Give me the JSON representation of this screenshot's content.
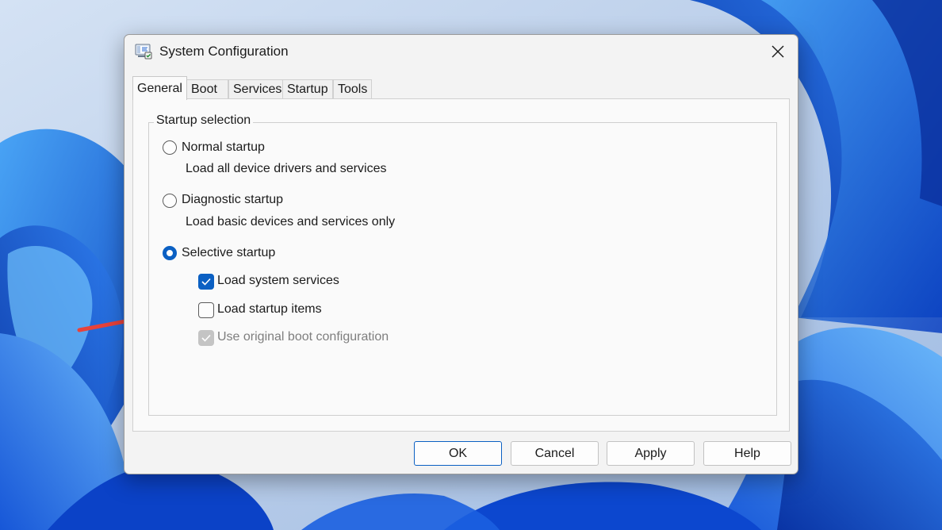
{
  "window": {
    "title": "System Configuration",
    "app_icon": "msconfig-icon",
    "close_icon": "close-icon"
  },
  "tabs": [
    {
      "label": "General",
      "active": true
    },
    {
      "label": "Boot",
      "active": false
    },
    {
      "label": "Services",
      "active": false
    },
    {
      "label": "Startup",
      "active": false
    },
    {
      "label": "Tools",
      "active": false
    }
  ],
  "startup_selection": {
    "label": "Startup selection",
    "normal": {
      "label": "Normal startup",
      "description": "Load all device drivers and services",
      "selected": false
    },
    "diagnostic": {
      "label": "Diagnostic startup",
      "description": "Load basic devices and services only",
      "selected": false
    },
    "selective": {
      "label": "Selective startup",
      "selected": true,
      "options": {
        "load_system_services": {
          "label": "Load system services",
          "checked": true
        },
        "load_startup_items": {
          "label": "Load startup items",
          "checked": false
        },
        "use_original_boot": {
          "label": "Use original boot configuration",
          "checked": true,
          "disabled": true
        }
      }
    }
  },
  "buttons": {
    "ok": "OK",
    "cancel": "Cancel",
    "apply": "Apply",
    "help": "Help"
  },
  "colors": {
    "accent": "#0b60c3",
    "annotation_arrow": "#e8423a"
  }
}
